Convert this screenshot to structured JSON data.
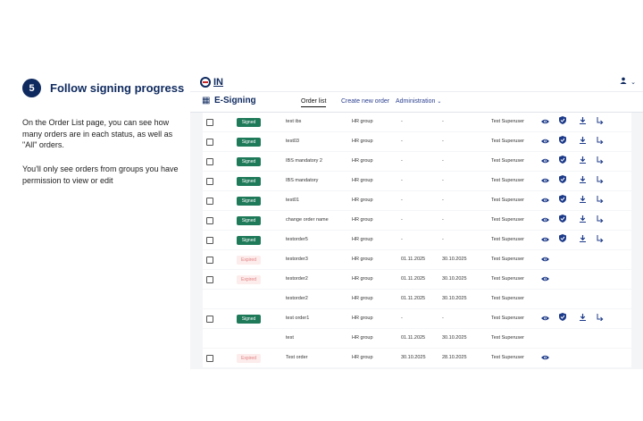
{
  "tutorial": {
    "step_number": "5",
    "title": "Follow signing progress",
    "para1": "On the Order List page, you can see how many orders are in each status, as well as \"All\" orders.",
    "para2": "You'll only see orders from groups you have permission to view or edit"
  },
  "app": {
    "logo_text": "IN",
    "app_name": "E-Signing",
    "user_icon": "user-icon",
    "nav": {
      "order_list": "Order list",
      "create_new_order": "Create new order",
      "administration": "Administration"
    }
  },
  "icons": {
    "grid": "grid-icon",
    "view": "eye-icon",
    "verify": "shield-check-icon",
    "download": "download-icon",
    "forward": "forward-icon"
  },
  "colors": {
    "brand": "#0f2a5f",
    "signed": "#1f7a5a",
    "expired_bg": "#fdecec",
    "expired_text": "#e08080",
    "action": "#1c3a8a"
  },
  "orders": [
    {
      "checkbox": true,
      "status": "Signed",
      "name": "test ibs",
      "group": "HR group",
      "date1": "-",
      "date2": "-",
      "user": "Test Superuser",
      "actions": [
        "view",
        "verify",
        "download",
        "forward"
      ]
    },
    {
      "checkbox": true,
      "status": "Signed",
      "name": "test03",
      "group": "HR group",
      "date1": "-",
      "date2": "-",
      "user": "Test Superuser",
      "actions": [
        "view",
        "verify",
        "download",
        "forward"
      ]
    },
    {
      "checkbox": true,
      "status": "Signed",
      "name": "IBS mandatory 2",
      "group": "HR group",
      "date1": "-",
      "date2": "-",
      "user": "Test Superuser",
      "actions": [
        "view",
        "verify",
        "download",
        "forward"
      ]
    },
    {
      "checkbox": true,
      "status": "Signed",
      "name": "IBS mandatory",
      "group": "HR group",
      "date1": "-",
      "date2": "-",
      "user": "Test Superuser",
      "actions": [
        "view",
        "verify",
        "download",
        "forward"
      ]
    },
    {
      "checkbox": true,
      "status": "Signed",
      "name": "test01",
      "group": "HR group",
      "date1": "-",
      "date2": "-",
      "user": "Test Superuser",
      "actions": [
        "view",
        "verify",
        "download",
        "forward"
      ]
    },
    {
      "checkbox": true,
      "status": "Signed",
      "name": "change order name",
      "group": "HR group",
      "date1": "-",
      "date2": "-",
      "user": "Test Superuser",
      "actions": [
        "view",
        "verify",
        "download",
        "forward"
      ]
    },
    {
      "checkbox": true,
      "status": "Signed",
      "name": "testorder5",
      "group": "HR group",
      "date1": "-",
      "date2": "-",
      "user": "Test Superuser",
      "actions": [
        "view",
        "verify",
        "download",
        "forward"
      ]
    },
    {
      "checkbox": true,
      "status": "Expired",
      "name": "testorder3",
      "group": "HR group",
      "date1": "01.11.2025",
      "date2": "30.10.2025",
      "user": "Test Superuser",
      "actions": [
        "view"
      ]
    },
    {
      "checkbox": true,
      "status": "Expired",
      "name": "testorder2",
      "group": "HR group",
      "date1": "01.11.2025",
      "date2": "30.10.2025",
      "user": "Test Superuser",
      "actions": [
        "view"
      ]
    },
    {
      "checkbox": false,
      "status": "",
      "name": "testorder2",
      "group": "HR group",
      "date1": "01.11.2025",
      "date2": "30.10.2025",
      "user": "Test Superuser",
      "actions": []
    },
    {
      "checkbox": true,
      "status": "Signed",
      "name": "test order1",
      "group": "HR group",
      "date1": "-",
      "date2": "-",
      "user": "Test Superuser",
      "actions": [
        "view",
        "verify",
        "download",
        "forward"
      ]
    },
    {
      "checkbox": false,
      "status": "",
      "name": "test",
      "group": "HR group",
      "date1": "01.11.2025",
      "date2": "30.10.2025",
      "user": "Test Superuser",
      "actions": []
    },
    {
      "checkbox": true,
      "status": "Expired",
      "name": "Test order",
      "group": "HR group",
      "date1": "30.10.2025",
      "date2": "28.10.2025",
      "user": "Test Superuser",
      "actions": [
        "view"
      ]
    }
  ]
}
